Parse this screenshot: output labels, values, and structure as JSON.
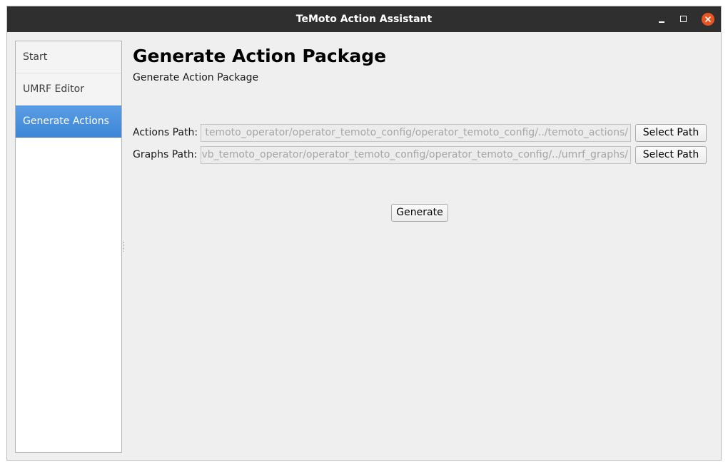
{
  "window": {
    "title": "TeMoto Action Assistant"
  },
  "sidebar": {
    "items": [
      {
        "label": "Start",
        "active": false
      },
      {
        "label": "UMRF Editor",
        "active": false
      },
      {
        "label": "Generate Actions",
        "active": true
      }
    ]
  },
  "main": {
    "title": "Generate Action Package",
    "subtitle": "Generate Action Package",
    "actions_path": {
      "label": "Actions Path:",
      "value": "temoto_operator/operator_temoto_config/operator_temoto_config/../temoto_actions/",
      "button_label": "Select Path"
    },
    "graphs_path": {
      "label": "Graphs Path:",
      "value": "vb_temoto_operator/operator_temoto_config/operator_temoto_config/../umrf_graphs/",
      "button_label": "Select Path"
    },
    "generate_label": "Generate"
  },
  "colors": {
    "titlebar": "#2f2f2f",
    "accent": "#3d86d7",
    "close": "#e95420"
  },
  "icons": {
    "minimize": "minimize-icon",
    "maximize": "maximize-icon",
    "close": "close-icon"
  }
}
